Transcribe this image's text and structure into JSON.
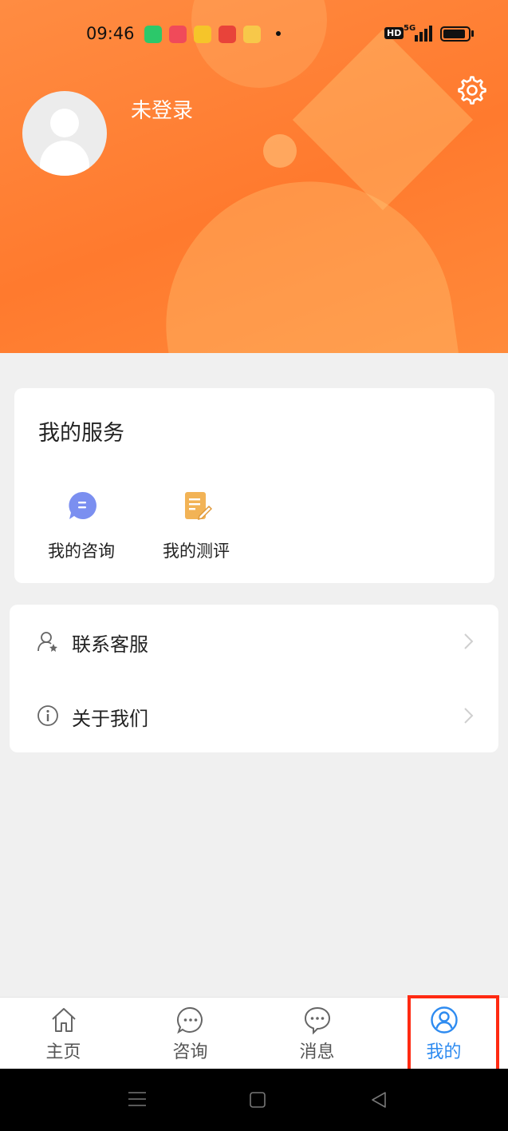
{
  "status_bar": {
    "time": "09:46",
    "hd_label": "HD",
    "network_label": "5G",
    "battery_level": 0.9
  },
  "profile": {
    "login_status": "未登录",
    "avatar_icon": "default-avatar-icon",
    "settings_icon": "gear-icon"
  },
  "services": {
    "title": "我的服务",
    "items": [
      {
        "label": "我的咨询",
        "icon": "chat-bubble-icon",
        "color": "#7b8ff0"
      },
      {
        "label": "我的测评",
        "icon": "document-edit-icon",
        "color": "#f2b356"
      }
    ]
  },
  "menu": {
    "items": [
      {
        "label": "联系客服",
        "icon": "customer-service-icon"
      },
      {
        "label": "关于我们",
        "icon": "info-icon"
      }
    ]
  },
  "tabbar": {
    "tabs": [
      {
        "label": "主页",
        "icon": "home-icon",
        "active": false
      },
      {
        "label": "咨询",
        "icon": "chat-icon",
        "active": false
      },
      {
        "label": "消息",
        "icon": "message-icon",
        "active": false
      },
      {
        "label": "我的",
        "icon": "user-icon",
        "active": true
      }
    ]
  },
  "colors": {
    "header_orange": "#ff7a2e",
    "accent_blue": "#2e8bf0",
    "highlight_red": "#ff2a12"
  }
}
